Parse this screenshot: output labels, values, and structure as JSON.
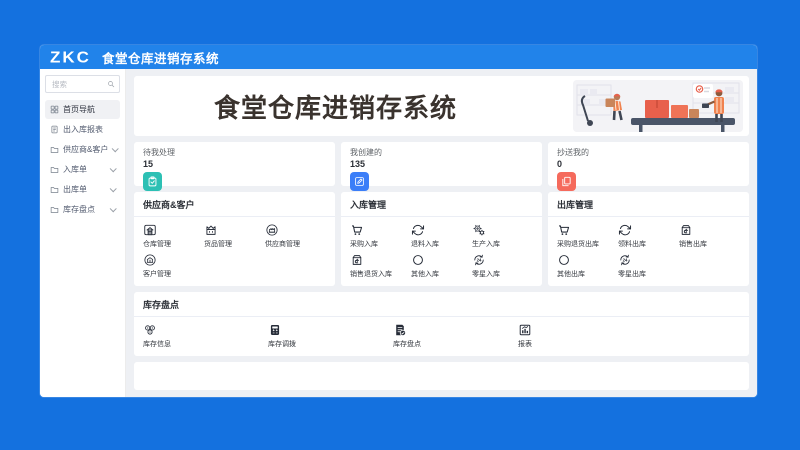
{
  "window": {
    "logo": "ZKC",
    "title": "食堂仓库进销存系统"
  },
  "sidebar": {
    "search_placeholder": "搜索",
    "items": [
      {
        "label": "首页导航",
        "icon": "dashboard",
        "active": true,
        "chevron": false
      },
      {
        "label": "出入库报表",
        "icon": "report",
        "active": false,
        "chevron": false
      },
      {
        "label": "供应商&客户",
        "icon": "folder",
        "active": false,
        "chevron": true
      },
      {
        "label": "入库单",
        "icon": "folder",
        "active": false,
        "chevron": true
      },
      {
        "label": "出库单",
        "icon": "folder",
        "active": false,
        "chevron": true
      },
      {
        "label": "库存盘点",
        "icon": "folder",
        "active": false,
        "chevron": true
      }
    ]
  },
  "banner": {
    "title": "食堂仓库进销存系统"
  },
  "stats": [
    {
      "label": "待我处理",
      "value": "15",
      "icon": "clipboard-check",
      "color": "#2cc0b4"
    },
    {
      "label": "我创建的",
      "value": "135",
      "icon": "edit",
      "color": "#3b7ef8"
    },
    {
      "label": "抄送我的",
      "value": "0",
      "icon": "copy-document",
      "color": "#f56a5c"
    }
  ],
  "sections": [
    {
      "title": "供应商&客户",
      "items": [
        {
          "label": "仓库管理",
          "icon": "warehouse"
        },
        {
          "label": "货品管理",
          "icon": "goods"
        },
        {
          "label": "供应商管理",
          "icon": "supplier"
        },
        {
          "label": "客户管理",
          "icon": "customer"
        }
      ]
    },
    {
      "title": "入库管理",
      "items": [
        {
          "label": "采购入库",
          "icon": "cart"
        },
        {
          "label": "退料入库",
          "icon": "refresh"
        },
        {
          "label": "生产入库",
          "icon": "gears"
        },
        {
          "label": "销售退货入库",
          "icon": "bag-return"
        },
        {
          "label": "其他入库",
          "icon": "circle"
        },
        {
          "label": "零星入库",
          "icon": "h24"
        }
      ]
    },
    {
      "title": "出库管理",
      "items": [
        {
          "label": "采购退货出库",
          "icon": "cart"
        },
        {
          "label": "领料出库",
          "icon": "refresh"
        },
        {
          "label": "销售出库",
          "icon": "bag-return"
        },
        {
          "label": "其他出库",
          "icon": "circle"
        },
        {
          "label": "零星出库",
          "icon": "h24"
        }
      ]
    },
    {
      "title": "库存盘点",
      "items": [
        {
          "label": "库存信息",
          "icon": "coins"
        },
        {
          "label": "库存调拨",
          "icon": "calculator"
        },
        {
          "label": "库存盘点",
          "icon": "doc-check"
        },
        {
          "label": "报表",
          "icon": "chart"
        }
      ]
    }
  ]
}
